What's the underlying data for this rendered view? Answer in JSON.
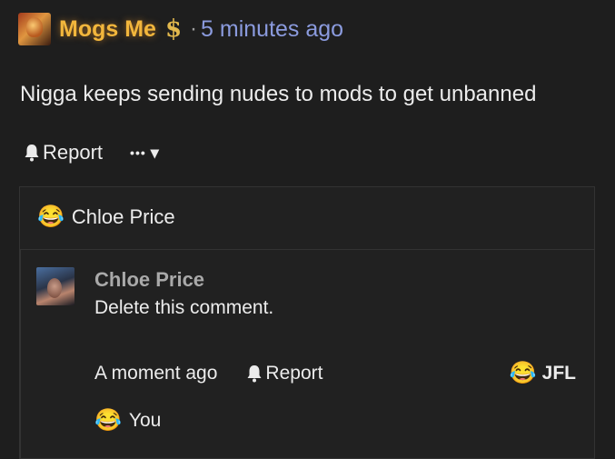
{
  "post": {
    "author": "Mogs Me",
    "donor_icon": "dollar-sign-icon",
    "donor_symbol": "$",
    "separator": "·",
    "timestamp": "5 minutes ago",
    "body": "Nigga keeps sending nudes to mods to get unbanned",
    "actions": {
      "report_label": "Report",
      "more_label": "•••",
      "more_caret": "▾"
    }
  },
  "reactions": {
    "emoji": "😂",
    "name": "Chloe Price"
  },
  "reply": {
    "author": "Chloe Price",
    "text": "Delete this comment.",
    "time": "A moment ago",
    "report_label": "Report",
    "react_emoji": "😂",
    "react_label": "JFL",
    "reaction_emoji": "😂",
    "reaction_name": "You"
  },
  "colors": {
    "background": "#1e1e1e",
    "author_gold": "#f2b63c",
    "timestamp_blue": "#8b9bde",
    "box_border": "#333333"
  }
}
